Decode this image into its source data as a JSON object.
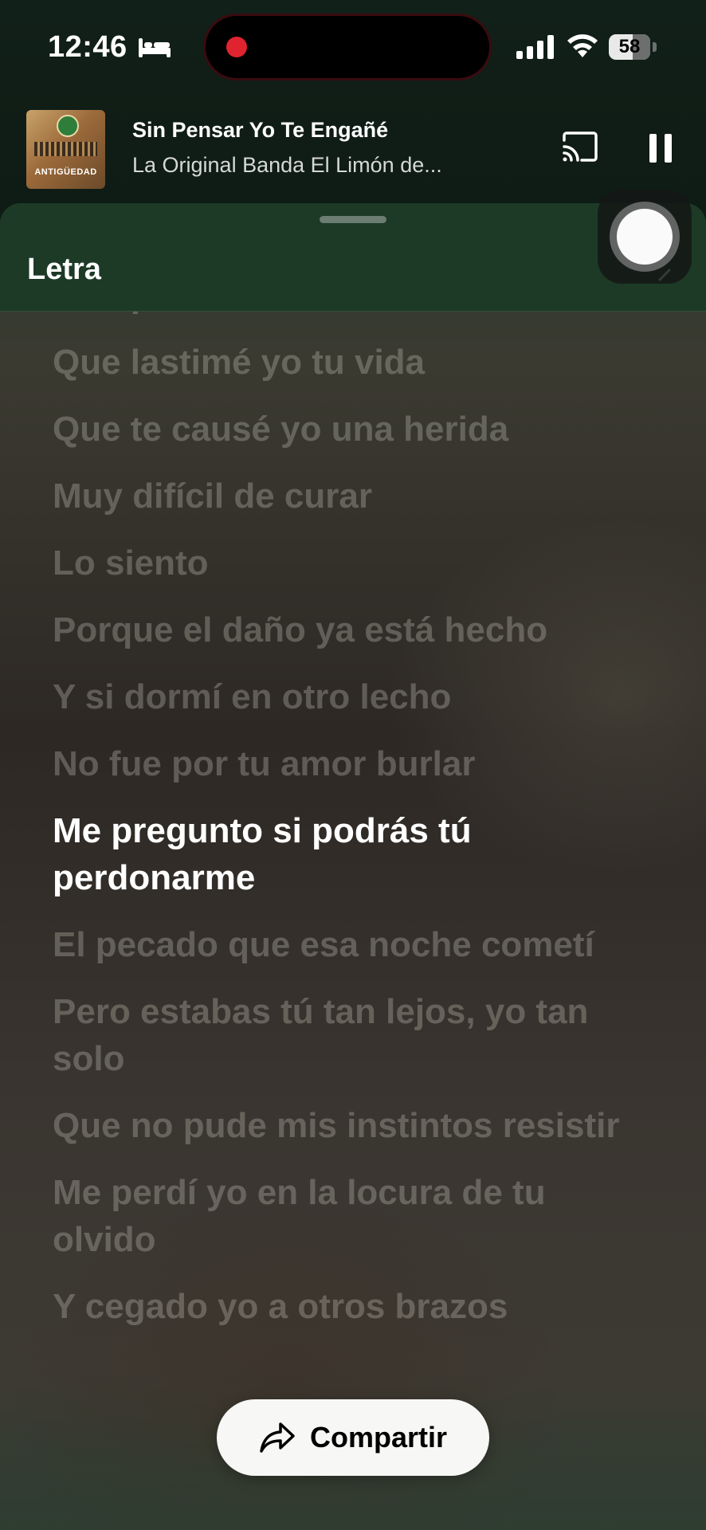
{
  "status_bar": {
    "time": "12:46",
    "battery_percent": "58",
    "battery_level": 0.58,
    "icons": [
      "bed-icon",
      "recording-indicator",
      "cellular-signal-icon",
      "wifi-icon",
      "battery-icon"
    ]
  },
  "now_playing": {
    "album_art_text": "ANTIGÜEDAD",
    "title": "Sin Pensar Yo Te Engañé",
    "artist": "La Original Banda El Limón de...",
    "icons": [
      "cast-icon",
      "pause-icon"
    ]
  },
  "sheet": {
    "title": "Letra"
  },
  "lyrics": {
    "lines": [
      "Comprendido",
      "Que lastimé yo tu vida",
      "Que te causé yo una herida",
      "Muy difícil de curar",
      "Lo siento",
      "Porque el daño ya está hecho",
      "Y si dormí en otro lecho",
      "No fue por tu amor burlar",
      "Me pregunto si podrás tú perdonarme",
      "El pecado que esa noche cometí",
      "Pero estabas tú tan lejos, yo tan solo",
      "Que no pude mis instintos resistir",
      "Me perdí yo en la locura de tu olvido",
      "Y cegado yo a otros brazos"
    ],
    "active_index": 8
  },
  "share": {
    "label": "Compartir",
    "icon": "share-arrow-icon"
  },
  "colors": {
    "header_green": "#1d3a26",
    "active_lyric": "#ffffff",
    "inactive_lyric": "rgba(190,190,180,0.34)",
    "share_button_bg": "#f7f7f5",
    "record_dot": "#e0242f"
  }
}
